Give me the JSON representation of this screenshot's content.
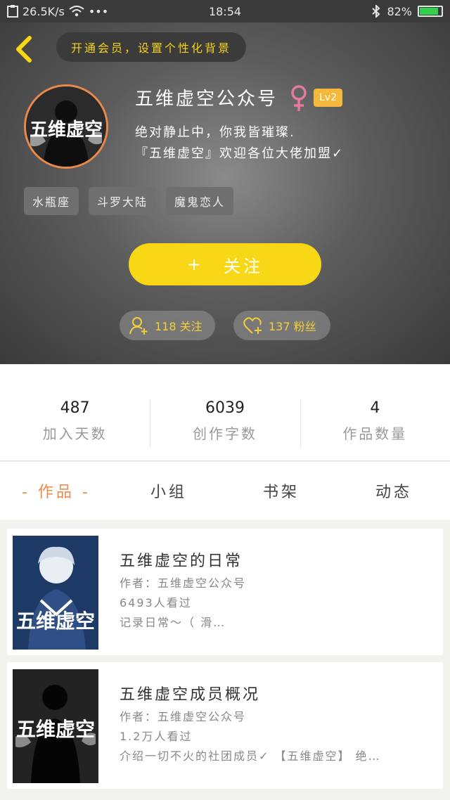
{
  "status_bar": {
    "net_speed": "26.5K/s",
    "more": "•••",
    "time": "18:54",
    "battery": "82%"
  },
  "header": {
    "vip_banner": "开通会员，设置个性化背景"
  },
  "profile": {
    "username": "五维虚空公众号",
    "level": "Lv2",
    "avatar_text": "五维虚空",
    "bio_line1": "绝对静止中，你我皆璀璨.",
    "bio_line2": "『五维虚空』欢迎各位大佬加盟✓",
    "tags": [
      "水瓶座",
      "斗罗大陆",
      "魔鬼恋人"
    ],
    "follow_plus": "+",
    "follow_label": "关注",
    "following": "118 关注",
    "fans": "137 粉丝"
  },
  "stats": [
    {
      "value": "487",
      "label": "加入天数"
    },
    {
      "value": "6039",
      "label": "创作字数"
    },
    {
      "value": "4",
      "label": "作品数量"
    }
  ],
  "tabs": [
    "- 作品 -",
    "小组",
    "书架",
    "动态"
  ],
  "books": [
    {
      "cover_text": "五维虚空",
      "title": "五维虚空的日常",
      "author": "作者：五维虚空公众号",
      "views": "6493人看过",
      "desc": "记录日常～（ 滑…"
    },
    {
      "cover_text": "五维虚空",
      "title": "五维虚空成员概况",
      "author": "作者：五维虚空公众号",
      "views": "1.2万人看过",
      "desc": "介绍一切不火的社团成员✓ 【五维虚空】 绝…"
    }
  ],
  "colors": {
    "accent_yellow": "#f7d716",
    "tab_active": "#f08a4b",
    "level_badge": "#f4b93b"
  }
}
